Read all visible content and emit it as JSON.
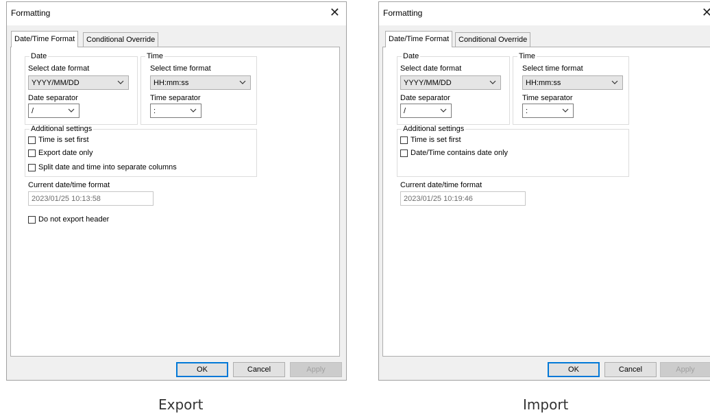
{
  "export_dialog": {
    "title": "Formatting",
    "tabs": [
      "Date/Time Format",
      "Conditional Override"
    ],
    "date_group": "Date",
    "time_group": "Time",
    "select_date_format_label": "Select date format",
    "date_format_value": "YYYY/MM/DD",
    "date_separator_label": "Date separator",
    "date_separator_value": "/",
    "select_time_format_label": "Select time format",
    "time_format_value": "HH:mm:ss",
    "time_separator_label": "Time separator",
    "time_separator_value": ":",
    "additional_group": "Additional settings",
    "checkboxes": [
      "Time is set first",
      "Export date only",
      "Split date and time into separate columns"
    ],
    "current_format_label": "Current date/time format",
    "current_format_value": "2023/01/25 10:13:58",
    "no_header_label": "Do not export header",
    "buttons": {
      "ok": "OK",
      "cancel": "Cancel",
      "apply": "Apply"
    },
    "caption": "Export"
  },
  "import_dialog": {
    "title": "Formatting",
    "tabs": [
      "Date/Time Format",
      "Conditional Override"
    ],
    "date_group": "Date",
    "time_group": "Time",
    "select_date_format_label": "Select date format",
    "date_format_value": "YYYY/MM/DD",
    "date_separator_label": "Date separator",
    "date_separator_value": "/",
    "select_time_format_label": "Select time format",
    "time_format_value": "HH:mm:ss",
    "time_separator_label": "Time separator",
    "time_separator_value": ":",
    "additional_group": "Additional settings",
    "checkboxes": [
      "Time is set first",
      "Date/Time contains date only"
    ],
    "current_format_label": "Current date/time format",
    "current_format_value": "2023/01/25 10:19:46",
    "buttons": {
      "ok": "OK",
      "cancel": "Cancel",
      "apply": "Apply"
    },
    "caption": "Import"
  },
  "icons": {
    "close": "close-icon",
    "dropdown": "chevron-down-icon",
    "checkbox": "checkbox-unchecked"
  },
  "colors": {
    "default_button_border": "#0078d7",
    "dialog_background": "#f0f0f0",
    "panel_background": "#ffffff"
  }
}
